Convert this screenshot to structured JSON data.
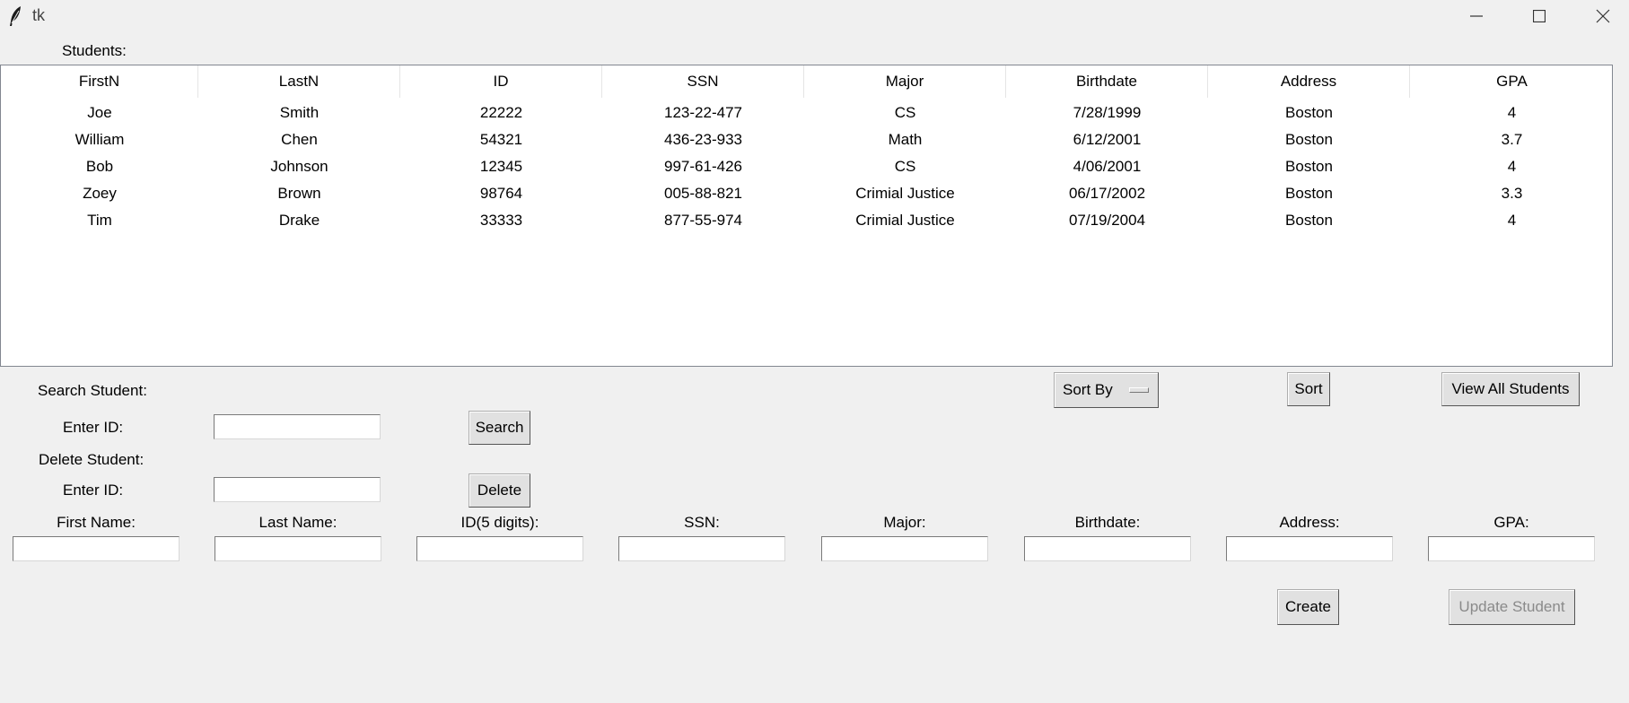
{
  "window": {
    "title": "tk",
    "app_icon": "feather-icon",
    "controls": [
      "minimize-icon",
      "maximize-icon",
      "close-icon"
    ]
  },
  "students_label": "Students:",
  "table": {
    "columns": [
      "FirstN",
      "LastN",
      "ID",
      "SSN",
      "Major",
      "Birthdate",
      "Address",
      "GPA"
    ],
    "rows": [
      [
        "Joe",
        "Smith",
        "22222",
        "123-22-477",
        "CS",
        "7/28/1999",
        "Boston",
        "4"
      ],
      [
        "William",
        "Chen",
        "54321",
        "436-23-933",
        "Math",
        "6/12/2001",
        "Boston",
        "3.7"
      ],
      [
        "Bob",
        "Johnson",
        "12345",
        "997-61-426",
        "CS",
        "4/06/2001",
        "Boston",
        "4"
      ],
      [
        "Zoey",
        "Brown",
        "98764",
        "005-88-821",
        "Crimial Justice",
        "06/17/2002",
        "Boston",
        "3.3"
      ],
      [
        "Tim",
        "Drake",
        "33333",
        "877-55-974",
        "Crimial Justice",
        "07/19/2004",
        "Boston",
        "4"
      ]
    ]
  },
  "search": {
    "section_label": "Search Student:",
    "id_label": "Enter ID:",
    "id_value": "",
    "button": "Search"
  },
  "delete": {
    "section_label": "Delete Student:",
    "id_label": "Enter ID:",
    "id_value": "",
    "button": "Delete"
  },
  "sort": {
    "menu_label": "Sort By",
    "button": "Sort"
  },
  "view_all_button": "View All Students",
  "form": {
    "labels": [
      "First Name:",
      "Last Name:",
      "ID(5 digits):",
      "SSN:",
      "Major:",
      "Birthdate:",
      "Address:",
      "GPA:"
    ],
    "values": [
      "",
      "",
      "",
      "",
      "",
      "",
      "",
      ""
    ]
  },
  "create_button": "Create",
  "update_button": "Update Student",
  "update_button_state": "disabled"
}
